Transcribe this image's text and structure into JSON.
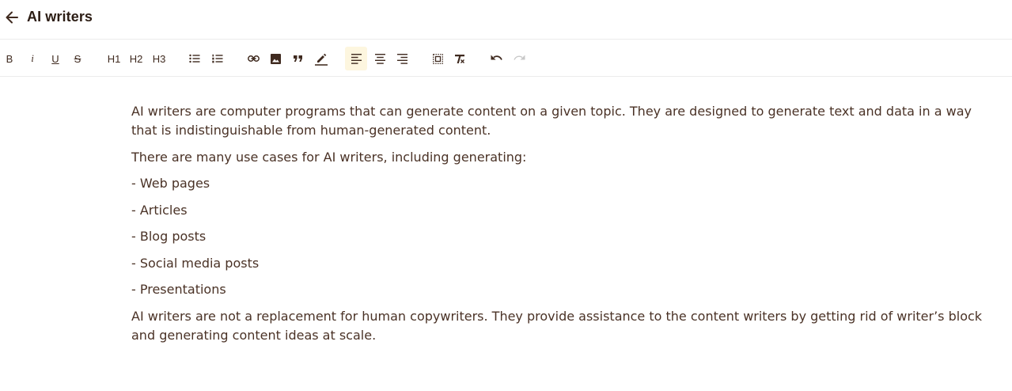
{
  "header": {
    "title": "AI writers"
  },
  "toolbar": {
    "bold": "B",
    "italic": "i",
    "underline": "U",
    "strike": "S",
    "h1": "H1",
    "h2": "H2",
    "h3": "H3"
  },
  "content": {
    "paragraph1": "AI writers are computer programs that can generate content on a given topic. They are designed to generate text and data in a way that is indistinguishable from human-generated content.",
    "paragraph2": "There are many use cases for AI writers, including generating:",
    "items": [
      "- Web pages",
      "- Articles",
      "- Blog posts",
      "- Social media posts",
      "- Presentations"
    ],
    "paragraph3": "AI writers are not a replacement for human copywriters. They provide assistance to the content writers by getting rid of writer’s block and generating content ideas at scale."
  },
  "colors": {
    "text": "#4a3226",
    "active_bg": "#fdf6df",
    "divider": "#ececec"
  }
}
